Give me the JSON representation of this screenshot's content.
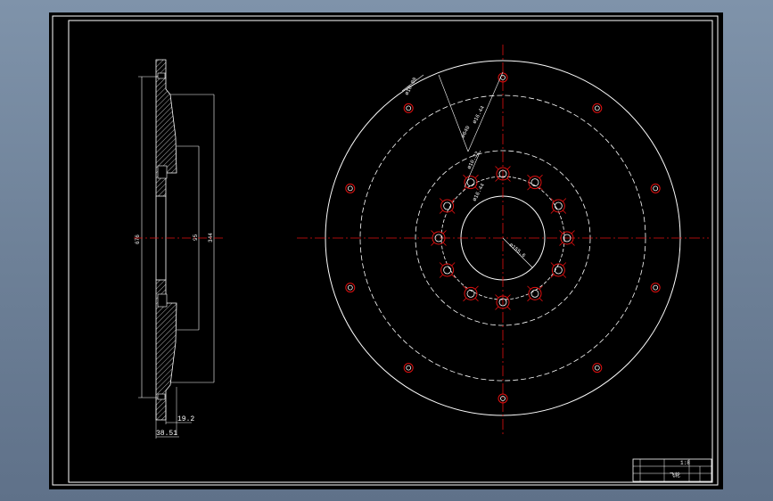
{
  "colors": {
    "background": "#000000",
    "frame": "#ffffff",
    "centerline": "#e01010",
    "hole_ring": "#e01010",
    "geometry": "#ffffff",
    "desktop": "#6e8198"
  },
  "side_view": {
    "dim_height": "676",
    "dim_inner_a": "95",
    "dim_inner_b": "344",
    "dim_flange": "19.2",
    "dim_total": "38.51"
  },
  "front_view": {
    "dims": [
      {
        "text": "ø10.08"
      },
      {
        "text": "ø16.44"
      },
      {
        "text": "ø640"
      },
      {
        "text": "ø10.32"
      },
      {
        "text": "ø16.44"
      },
      {
        "text": "ø155.6"
      }
    ]
  },
  "title_block": {
    "top_text": "1:8",
    "name": "飞轮"
  }
}
